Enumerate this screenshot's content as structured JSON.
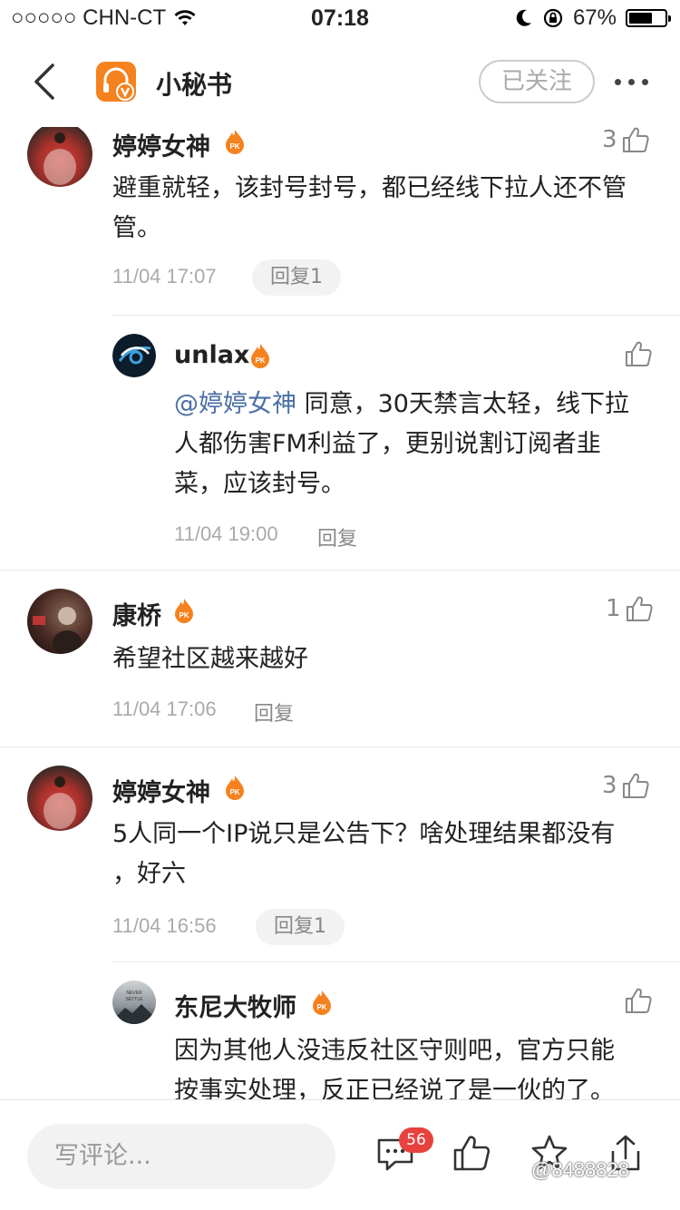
{
  "status_bar": {
    "carrier": "○○○○○ CHN-CT",
    "time": "07:18",
    "battery_pct": "67%",
    "battery_level": 0.67
  },
  "nav": {
    "title": "小秘书",
    "follow_label": "已关注"
  },
  "comments": [
    {
      "user": "婷婷女神",
      "text_line1": "避重就轻，该封号封号，都已经线下拉人还不管",
      "text_line2": "管。",
      "time": "11/04 17:07",
      "reply": "回复1",
      "likes": "3"
    },
    {
      "user": "unlax",
      "mention": "@婷婷女神",
      "text_line1": " 同意，30天禁言太轻，线下拉",
      "text_line2": "人都伤害FM利益了，更别说割订阅者韭",
      "text_line3": "菜，应该封号。",
      "time": "11/04 19:00",
      "reply": "回复"
    },
    {
      "user": "康桥",
      "text_line1": "希望社区越来越好",
      "time": "11/04 17:06",
      "reply": "回复",
      "likes": "1"
    },
    {
      "user": "婷婷女神",
      "text_line1": "5人同一个IP说只是公告下？啥处理结果都没有",
      "text_line2": "，好六",
      "time": "11/04 16:56",
      "reply": "回复1",
      "likes": "3"
    },
    {
      "user": "东尼大牧师",
      "avatar_text": "NEVER SETTLE",
      "text_line1": "因为其他人没违反社区守则吧，官方只能",
      "text_line2": "按事实处理，反正已经说了是一伙的了。"
    }
  ],
  "bottom": {
    "placeholder": "写评论...",
    "comment_count": "56",
    "watermark": "@8488828"
  },
  "colors": {
    "accent": "#f5821f",
    "mention": "#4a6fa5",
    "badge_red": "#e8423f"
  },
  "icons": [
    "back-arrow-icon",
    "app-logo-icon",
    "more-icon",
    "pk-badge-icon",
    "thumb-up-icon",
    "comment-icon",
    "star-icon",
    "share-icon",
    "wifi-icon",
    "moon-icon",
    "rotation-lock-icon"
  ]
}
